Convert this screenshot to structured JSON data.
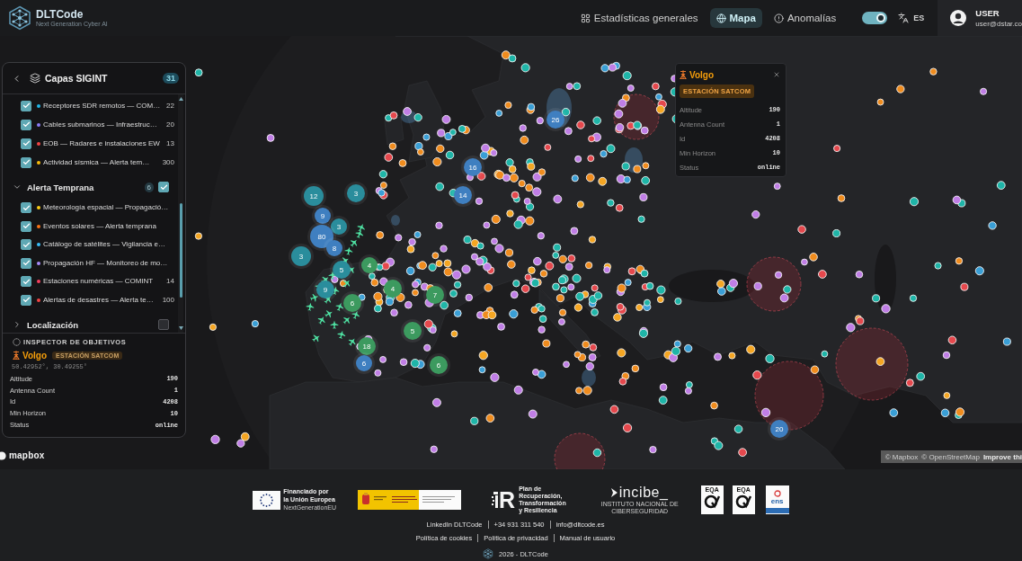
{
  "header": {
    "brand": "DLTCode",
    "tagline": "Next Generation Cyber AI",
    "nav": [
      {
        "label": "Estadísticas generales",
        "selected": false
      },
      {
        "label": "Mapa",
        "selected": true
      },
      {
        "label": "Anomalías",
        "selected": false
      }
    ],
    "theme_toggle": {
      "on": true
    },
    "language": "ES",
    "user": {
      "name": "USER",
      "email": "user@dstar.co"
    }
  },
  "layers_panel": {
    "title": "Capas SIGINT",
    "count": "31",
    "layers": [
      {
        "kind": "layer",
        "label": "Receptores SDR remotos — COM…",
        "color": "#1fb6e8",
        "count": "22",
        "checked": true
      },
      {
        "kind": "layer",
        "label": "Cables submarinos — Infraestruc…",
        "color": "#8b7cf6",
        "count": "20",
        "checked": true
      },
      {
        "kind": "layer",
        "label": "EOB — Radares e instalaciones EW",
        "color": "#ef4444",
        "count": "13",
        "checked": true
      },
      {
        "kind": "layer",
        "label": "Actividad sísmica — Alerta tem…",
        "color": "#f5b90b",
        "count": "300",
        "checked": true
      },
      {
        "kind": "group",
        "label": "Alerta Temprana",
        "count": "6",
        "checked": true,
        "expanded": true,
        "children": [
          {
            "kind": "layer",
            "label": "Meteorología espacial — Propagació…",
            "color": "#facc15",
            "checked": true
          },
          {
            "kind": "layer",
            "label": "Eventos solares — Alerta temprana",
            "color": "#f97316",
            "checked": true
          },
          {
            "kind": "layer",
            "label": "Catálogo de satélites — Vigilancia e…",
            "color": "#38bdf8",
            "checked": true
          },
          {
            "kind": "layer",
            "label": "Propagación HF — Monitoreo de mo…",
            "color": "#a78bfa",
            "checked": true
          },
          {
            "kind": "layer",
            "label": "Estaciones numéricas — COMINT",
            "color": "#f43f5e",
            "count": "14",
            "checked": true
          },
          {
            "kind": "layer",
            "label": "Alertas de desastres — Alerta te…",
            "color": "#ef4444",
            "count": "100",
            "checked": true
          }
        ]
      },
      {
        "kind": "group",
        "label": "Localización",
        "checked": false,
        "expanded": false
      }
    ],
    "inspector": {
      "title": "INSPECTOR DE OBJETIVOS",
      "name": "Volgo",
      "type": "ESTACIÓN SATCOM",
      "coords": "50.42952°, 30.49255°",
      "fields": [
        {
          "label": "Altitude",
          "value": "190"
        },
        {
          "label": "Antenna Count",
          "value": "1"
        },
        {
          "label": "Id",
          "value": "4208"
        },
        {
          "label": "Min Horizon",
          "value": "10"
        },
        {
          "label": "Status",
          "value": "online"
        }
      ]
    }
  },
  "map_popup": {
    "name": "Volgo",
    "type": "ESTACIÓN SATCOM",
    "fields": [
      {
        "label": "Altitude",
        "value": "190"
      },
      {
        "label": "Antenna Count",
        "value": "1"
      },
      {
        "label": "Id",
        "value": "4208"
      },
      {
        "label": "Min Horizon",
        "value": "10"
      },
      {
        "label": "Status",
        "value": "online"
      }
    ]
  },
  "map": {
    "clusters": [
      {
        "count": "12",
        "color": "#2a8d9c"
      },
      {
        "count": "3",
        "color": "#2a8d9c"
      },
      {
        "count": "9",
        "color": "#3f7fc0"
      },
      {
        "count": "3",
        "color": "#2a8d9c"
      },
      {
        "count": "80",
        "color": "#3f7fc0"
      },
      {
        "count": "8",
        "color": "#3f7fc0"
      },
      {
        "count": "3",
        "color": "#2a8d9c"
      },
      {
        "count": "4",
        "color": "#3c9a5f"
      },
      {
        "count": "5",
        "color": "#2a8d9c"
      },
      {
        "count": "9",
        "color": "#2a8d9c"
      },
      {
        "count": "6",
        "color": "#3c9a5f"
      },
      {
        "count": "4",
        "color": "#3c9a5f"
      },
      {
        "count": "7",
        "color": "#3c9a5f"
      },
      {
        "count": "5",
        "color": "#3c9a5f"
      },
      {
        "count": "18",
        "color": "#3c9a5f"
      },
      {
        "count": "6",
        "color": "#3f7fc0"
      },
      {
        "count": "6",
        "color": "#3c9a5f"
      },
      {
        "count": "16",
        "color": "#3f7fc0"
      },
      {
        "count": "14",
        "color": "#3f7fc0"
      },
      {
        "count": "26",
        "color": "#3f7fc0"
      },
      {
        "count": "20",
        "color": "#3f7fc0"
      }
    ],
    "brand": "mapbox",
    "attribution": [
      "© Mapbox",
      "© OpenStreetMap",
      "Improve thi"
    ]
  },
  "footer": {
    "logos": [
      {
        "kind": "eu",
        "title": "Financiado por\nla Unión Europea",
        "subtitle": "NextGenerationEU"
      },
      {
        "kind": "gov"
      },
      {
        "kind": "recovery",
        "mark": "R",
        "text": "Plan de\nRecuperación,\nTransformación\ny Resiliencia"
      },
      {
        "kind": "incibe",
        "name": "incibe_",
        "subtitle": "INSTITUTO NACIONAL DE CIBERSEGURIDAD"
      },
      {
        "kind": "eqa",
        "label": "EQA"
      },
      {
        "kind": "eqa",
        "label": "EQA"
      },
      {
        "kind": "ens",
        "label": "ens"
      }
    ],
    "contact_links": [
      "LinkedIn DLTCode",
      "+34 931 311 540",
      "info@dltcode.es"
    ],
    "legal_links": [
      "Política de cookies",
      "Política de privacidad",
      "Manual de usuario"
    ],
    "copyright": "2026 - DLTCode"
  }
}
